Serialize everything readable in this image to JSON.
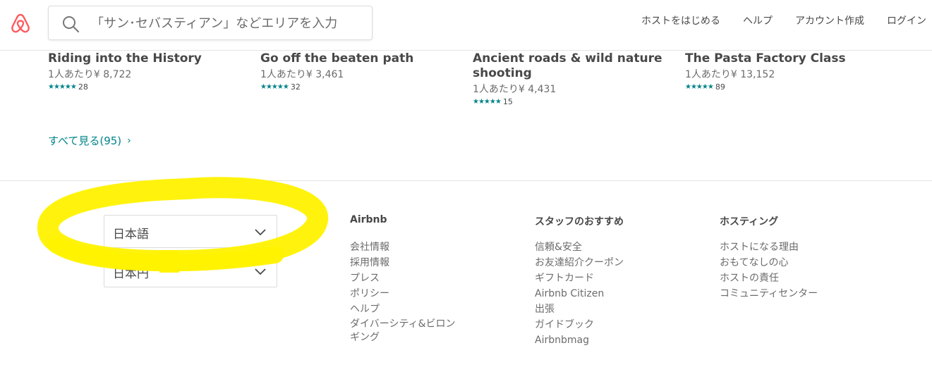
{
  "header": {
    "search_placeholder": "「サン･セバスティアン」などエリアを入力",
    "nav": [
      "ホストをはじめる",
      "ヘルプ",
      "アカウント作成",
      "ログイン"
    ]
  },
  "experiences": [
    {
      "title": "Riding into the History",
      "price": "1人あたり¥ 8,722",
      "stars": "★★★★★",
      "reviews": "28"
    },
    {
      "title": "Go off the beaten path",
      "price": "1人あたり¥ 3,461",
      "stars": "★★★★★",
      "reviews": "32"
    },
    {
      "title": "Ancient roads & wild nature shooting",
      "price": "1人あたり¥ 4,431",
      "stars": "★★★★★",
      "reviews": "15"
    },
    {
      "title": "The Pasta Factory Class",
      "price": "1人あたり¥ 13,152",
      "stars": "★★★★★",
      "reviews": "89"
    }
  ],
  "see_all": {
    "label": "すべて見る(95)",
    "chevron": "›"
  },
  "footer": {
    "language": "日本語",
    "currency": "日本円",
    "columns": [
      {
        "title": "Airbnb",
        "links": [
          "会社情報",
          "採用情報",
          "プレス",
          "ポリシー",
          "ヘルプ",
          "ダイバーシティ&ビロンギング"
        ]
      },
      {
        "title": "スタッフのおすすめ",
        "links": [
          "信頼&安全",
          "お友達紹介クーポン",
          "ギフトカード",
          "Airbnb Citizen",
          "出張",
          "ガイドブック",
          "Airbnbmag"
        ]
      },
      {
        "title": "ホスティング",
        "links": [
          "ホストになる理由",
          "おもてなしの心",
          "ホストの責任",
          "コミュニティセンター"
        ]
      }
    ]
  },
  "colors": {
    "brand": "#ff5a5f",
    "teal": "#008489",
    "highlight": "#fff200"
  }
}
